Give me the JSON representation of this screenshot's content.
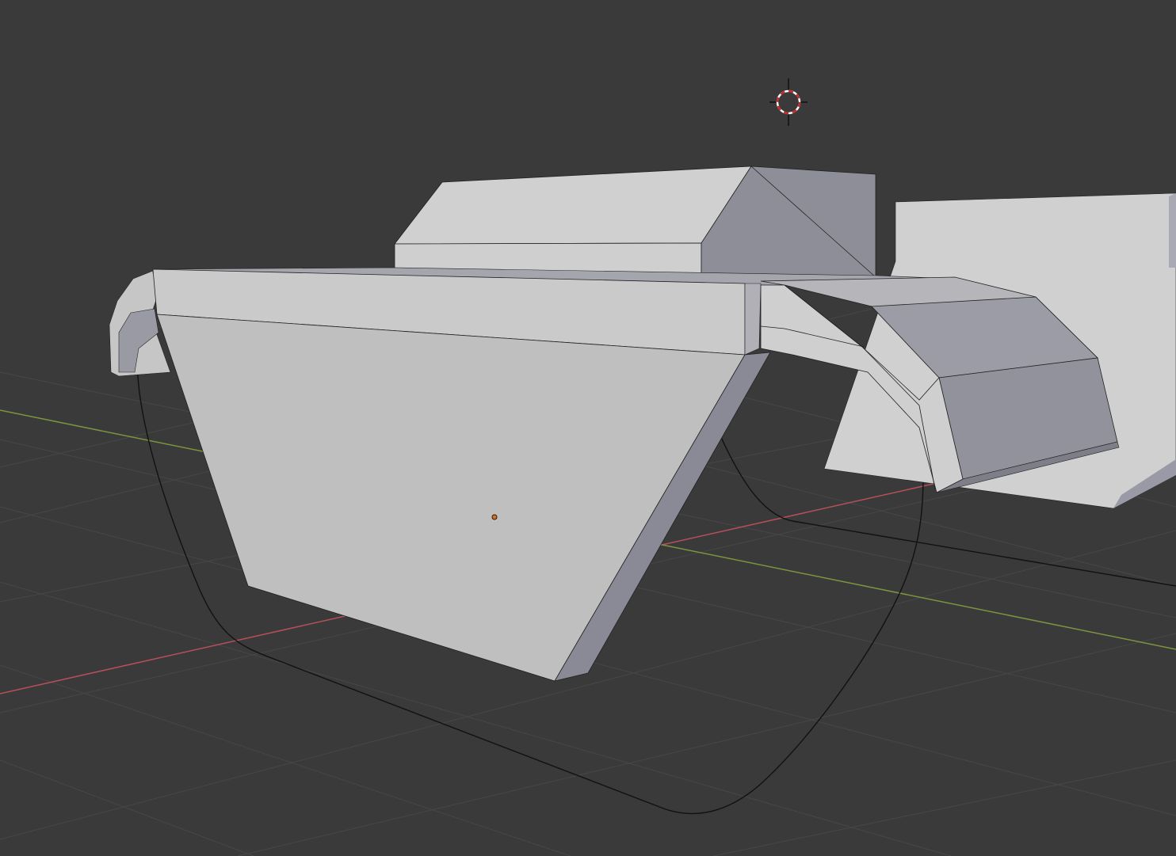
{
  "viewport": {
    "type": "3d-viewport",
    "background_color": "#3a3a3a",
    "grid_color": "#4a4a4a",
    "x_axis_color": "#b5505a",
    "y_axis_color": "#7c9440",
    "object_light_color": "#c4c4c4",
    "object_shade_color": "#8e8e98",
    "outline_color": "#111111",
    "origin_dot_color": "#e0701a",
    "cursor_icon": "3d-cursor-icon"
  }
}
